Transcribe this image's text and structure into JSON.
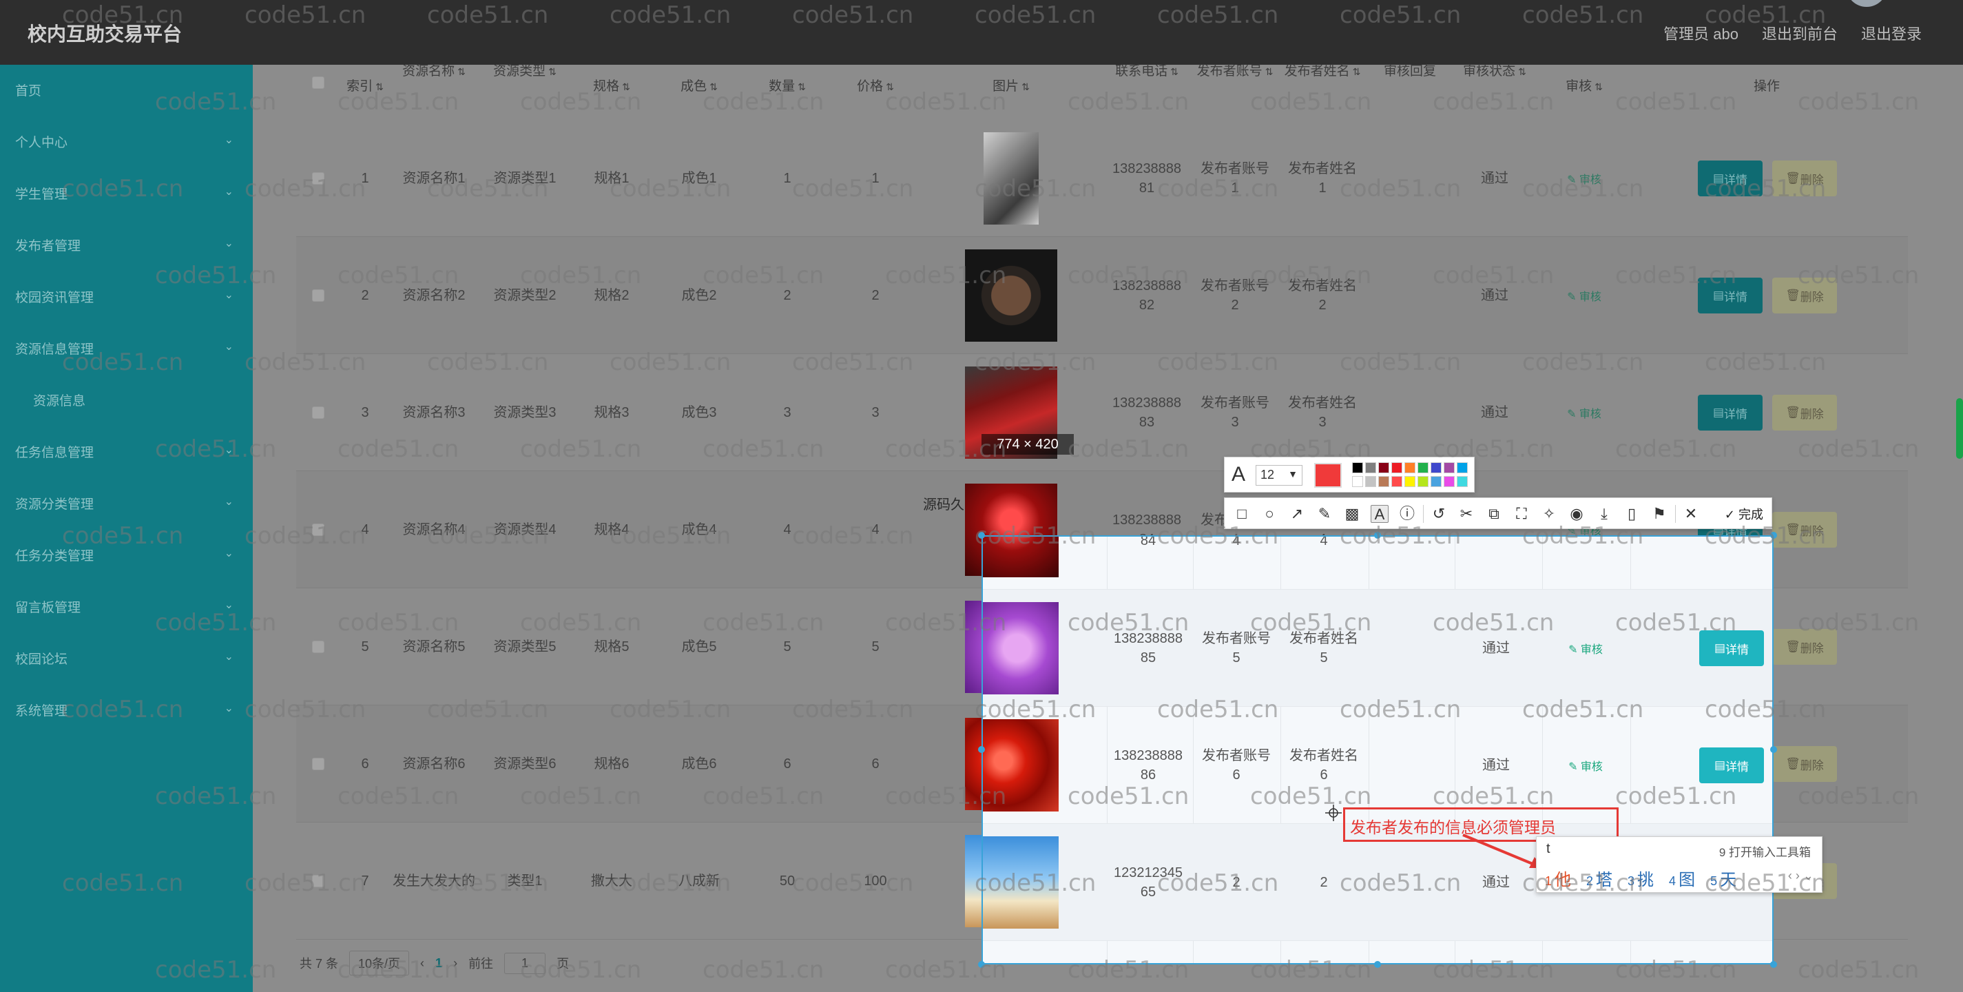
{
  "header": {
    "brand": "校内互助交易平台",
    "links": [
      "管理员 abo",
      "退出到前台",
      "退出登录"
    ]
  },
  "sidebar": {
    "items": [
      {
        "label": "首页",
        "chev": false
      },
      {
        "label": "个人中心",
        "chev": true
      },
      {
        "label": "学生管理",
        "chev": true
      },
      {
        "label": "发布者管理",
        "chev": true
      },
      {
        "label": "校园资讯管理",
        "chev": true
      },
      {
        "label": "资源信息管理",
        "chev": true
      },
      {
        "label": "资源信息",
        "chev": false,
        "sub": true
      },
      {
        "label": "任务信息管理",
        "chev": true
      },
      {
        "label": "资源分类管理",
        "chev": true
      },
      {
        "label": "任务分类管理",
        "chev": true
      },
      {
        "label": "留言板管理",
        "chev": true
      },
      {
        "label": "校园论坛",
        "chev": true
      },
      {
        "label": "系统管理",
        "chev": true
      }
    ]
  },
  "table": {
    "headers": [
      "索引",
      "资源名称",
      "资源类型",
      "规格",
      "成色",
      "数量",
      "价格",
      "图片",
      "联系电话",
      "发布者账号",
      "发布者姓名",
      "审核回复",
      "审核状态",
      "审核",
      "操作"
    ],
    "sort_icon": "⇅",
    "rows": [
      {
        "idx": "1",
        "name": "资源名称1",
        "type": "资源类型1",
        "spec": "规格1",
        "cond": "成色1",
        "qty": "1",
        "price": "1",
        "img": "book",
        "phone": [
          "138238888",
          "81"
        ],
        "acct": [
          "发布者账号",
          "1"
        ],
        "pname": [
          "发布者姓名",
          "1"
        ],
        "reply": "",
        "status": "通过"
      },
      {
        "idx": "2",
        "name": "资源名称2",
        "type": "资源类型2",
        "spec": "规格2",
        "cond": "成色2",
        "qty": "2",
        "price": "2",
        "img": "watch",
        "phone": [
          "138238888",
          "82"
        ],
        "acct": [
          "发布者账号",
          "2"
        ],
        "pname": [
          "发布者姓名",
          "2"
        ],
        "reply": "",
        "status": "通过"
      },
      {
        "idx": "3",
        "name": "资源名称3",
        "type": "资源类型3",
        "spec": "规格3",
        "cond": "成色3",
        "qty": "3",
        "price": "3",
        "img": "shoe",
        "phone": [
          "138238888",
          "83"
        ],
        "acct": [
          "发布者账号",
          "3"
        ],
        "pname": [
          "发布者姓名",
          "3"
        ],
        "reply": "",
        "status": "通过"
      },
      {
        "idx": "4",
        "name": "资源名称4",
        "type": "资源类型4",
        "spec": "规格4",
        "cond": "成色4",
        "qty": "4",
        "price": "4",
        "img": "red",
        "phone": [
          "138238888",
          "84"
        ],
        "acct": [
          "发布者账号",
          "4"
        ],
        "pname": [
          "发布者姓名",
          "4"
        ],
        "reply": "",
        "status": ""
      },
      {
        "idx": "5",
        "name": "资源名称5",
        "type": "资源类型5",
        "spec": "规格5",
        "cond": "成色5",
        "qty": "5",
        "price": "5",
        "img": "purple",
        "phone": [
          "138238888",
          "85"
        ],
        "acct": [
          "发布者账号",
          "5"
        ],
        "pname": [
          "发布者姓名",
          "5"
        ],
        "reply": "",
        "status": "通过"
      },
      {
        "idx": "6",
        "name": "资源名称6",
        "type": "资源类型6",
        "spec": "规格6",
        "cond": "成色6",
        "qty": "6",
        "price": "6",
        "img": "cherry",
        "phone": [
          "138238888",
          "86"
        ],
        "acct": [
          "发布者账号",
          "6"
        ],
        "pname": [
          "发布者姓名",
          "6"
        ],
        "reply": "",
        "status": "通过"
      },
      {
        "idx": "7",
        "name": "发生大发大的",
        "type": "类型1",
        "spec": "撒大大",
        "cond": "八成新",
        "qty": "50",
        "price": "100",
        "img": "sky",
        "phone": [
          "123212345",
          "65"
        ],
        "acct": [
          "",
          "2"
        ],
        "pname": [
          "",
          "2"
        ],
        "reply": "",
        "status": "通过"
      }
    ],
    "audit_label": "审核",
    "detail_label": "详情",
    "delete_label": "删除"
  },
  "pager": {
    "total": "共 7 条",
    "size": "10条/页",
    "prev": "‹",
    "current": "1",
    "next": "›",
    "goto": "前往",
    "page_value": "1",
    "page_unit": "页"
  },
  "watermark": "code51.cn",
  "screenshot_tool": {
    "size_label": "774 × 420",
    "source_label": "源码久",
    "font_size": "12",
    "current_color": "#f03a3a",
    "palette": [
      "#000000",
      "#7f7f7f",
      "#880015",
      "#ed1c24",
      "#ff7f27",
      "#22b14c",
      "#3f48cc",
      "#a349a4",
      "#00a2e8",
      "#ffffff",
      "#c3c3c3",
      "#b97a57",
      "#ff4b4b",
      "#fff200",
      "#b5e61d",
      "#4aa3df",
      "#e84ce8",
      "#3fd9e0"
    ],
    "tools": [
      "rect-icon",
      "ellipse-icon",
      "arrow-icon",
      "pen-icon",
      "mosaic-icon",
      "text-icon",
      "serial-icon",
      "undo-icon",
      "pin-icon",
      "ocr-icon",
      "scan-icon",
      "pushpin-icon",
      "record-icon",
      "download-icon",
      "phone-icon",
      "bookmark-icon",
      "close-icon"
    ],
    "done_label": "完成",
    "annotation": "发布者发布的信息必须管理员"
  },
  "ime": {
    "composition": "t",
    "toolbox": "9 打开输入工具箱",
    "candidates": [
      {
        "n": "1",
        "c": "他"
      },
      {
        "n": "2",
        "c": "塔"
      },
      {
        "n": "3",
        "c": "挑"
      },
      {
        "n": "4",
        "c": "图"
      },
      {
        "n": "5",
        "c": "天"
      }
    ],
    "nav": "‹ ›  ⌄"
  }
}
